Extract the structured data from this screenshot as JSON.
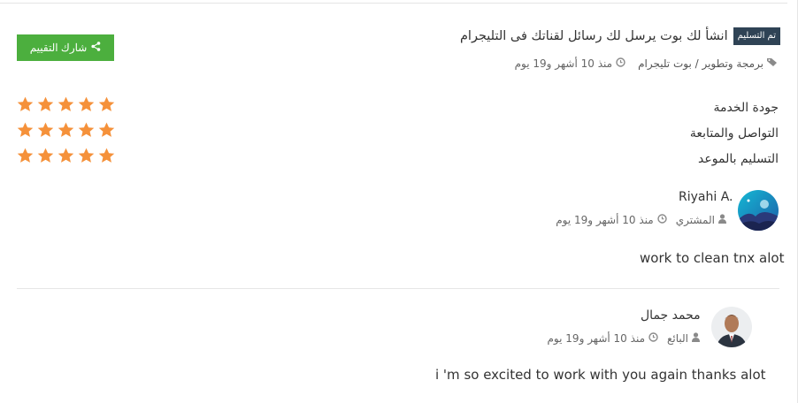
{
  "header": {
    "badge": "تم التسليم",
    "title": "انشأ لك بوت يرسل لك رسائل لقناتك فى التليجرام",
    "category": "برمجة وتطوير / بوت تليجرام",
    "time": "منذ 10 أشهر و19 يوم"
  },
  "share_button": {
    "label": "شارك التقييم"
  },
  "ratings": [
    {
      "label": "جودة الخدمة",
      "stars": 5
    },
    {
      "label": "التواصل والمتابعة",
      "stars": 5
    },
    {
      "label": "التسليم بالموعد",
      "stars": 5
    }
  ],
  "reviews": [
    {
      "name": "Riyahi A.",
      "role": "المشتري",
      "time": "منذ 10 أشهر و19 يوم",
      "comment": "work to clean tnx alot"
    },
    {
      "name": "محمد جمال",
      "role": "البائع",
      "time": "منذ 10 أشهر و19 يوم",
      "comment": "i 'm so excited to work with you again thanks alot"
    }
  ],
  "colors": {
    "star": "#f5913a",
    "share_button": "#4caf3e",
    "badge": "#2f4355"
  },
  "icons": {
    "tag": "tag-icon",
    "clock": "clock-icon",
    "user": "user-icon",
    "share": "share-icon",
    "star": "star-icon"
  }
}
